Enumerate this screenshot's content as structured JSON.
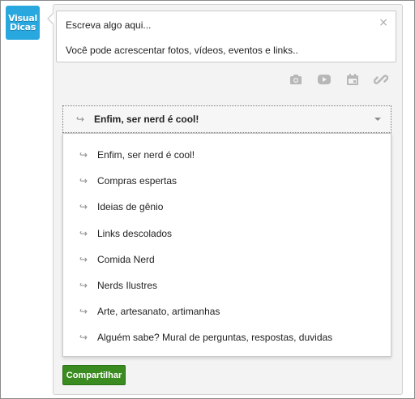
{
  "avatar": {
    "line1": "Visual",
    "line2": "Dicas"
  },
  "composer": {
    "line1": "Escreva algo aqui...",
    "line2": "Você pode acrescentar fotos, vídeos, eventos e links..",
    "close_glyph": "×"
  },
  "attachments": [
    "camera-icon",
    "video-icon",
    "calendar-icon",
    "link-icon"
  ],
  "category_select": {
    "hook_glyph": "↪",
    "selected": "Enfim, ser nerd é cool!",
    "options": [
      "Enfim, ser nerd é cool!",
      "Compras espertas",
      "Ideias de gênio",
      "Links descolados",
      "Comida Nerd",
      "Nerds Ilustres",
      "Arte, artesanato, artimanhas",
      "Alguém sabe? Mural de perguntas, respostas, duvidas"
    ]
  },
  "share_button": {
    "label": "Compartilhar"
  },
  "colors": {
    "accent": "#3a8b20",
    "avatar_bg": "#29a8e0",
    "icon": "#b7b7b7"
  }
}
